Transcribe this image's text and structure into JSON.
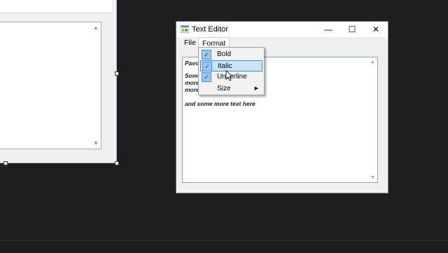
{
  "background_form": {
    "textbox_scroll": {
      "up_glyph": "▲",
      "down_glyph": "▼"
    }
  },
  "window": {
    "title": "Text Editor",
    "caption": {
      "minimize": "—",
      "maximize": "☐",
      "close": "✕"
    },
    "menu": {
      "file_label": "File",
      "format_label": "Format"
    },
    "format_dropdown": {
      "items": [
        {
          "label": "Bold",
          "checked": true
        },
        {
          "label": "Italic",
          "checked": true
        },
        {
          "label": "Underline",
          "checked": true
        },
        {
          "label": "Size",
          "checked": false,
          "submenu": true
        }
      ],
      "check_glyph": "✓",
      "submenu_glyph": "▶"
    },
    "richtext": {
      "lines": [
        "Pavo",
        "Some",
        "more",
        "more",
        "and some more text here"
      ],
      "scroll_up": "▲",
      "scroll_down": "▼"
    }
  },
  "colors": {
    "highlight": "#cce4f7",
    "highlight_border": "#3d8fd6",
    "checkbox": "#9ac8f0"
  }
}
